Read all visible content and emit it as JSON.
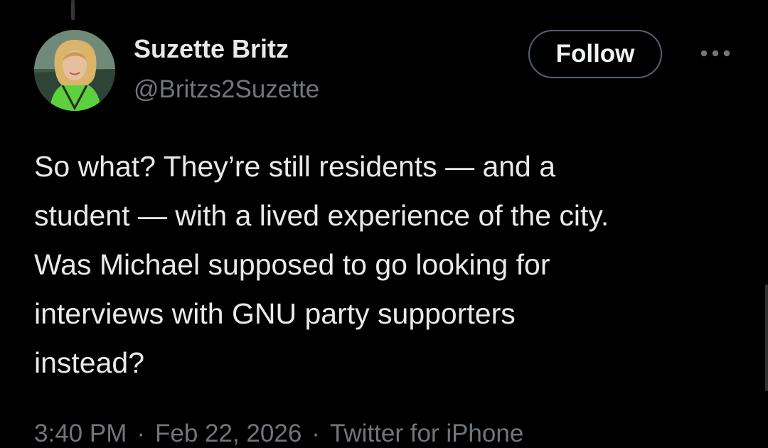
{
  "author": {
    "display_name": "Suzette Britz",
    "handle": "@Britzs2Suzette",
    "avatar_icon": "profile-photo"
  },
  "actions": {
    "follow_label": "Follow",
    "more_icon": "more-horizontal-icon"
  },
  "tweet": {
    "lines": [
      "So what? They’re still residents — and a",
      "student — with a lived experience of the city.",
      "Was Michael supposed to go looking for",
      "interviews with GNU party supporters",
      "instead?"
    ]
  },
  "meta": {
    "time": "3:40 PM",
    "separator_1": "·",
    "date": "Feb 22, 2026",
    "separator_2": "·",
    "source": "Twitter for iPhone"
  },
  "colors": {
    "background": "#000000",
    "primary_text": "#e7e9ea",
    "secondary_text": "#71767b",
    "follow_border": "#536471"
  }
}
